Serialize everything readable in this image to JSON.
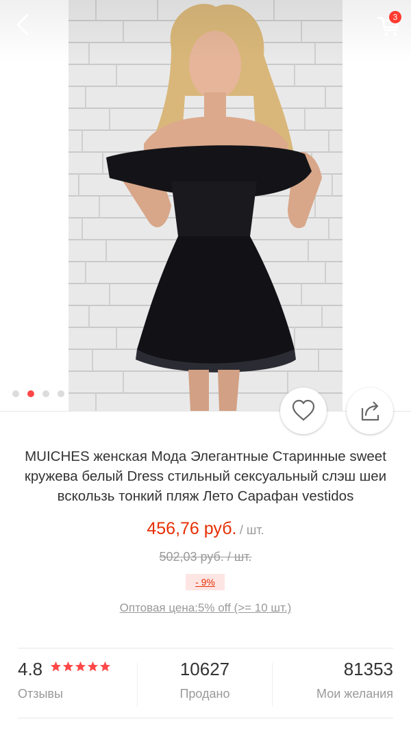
{
  "colors": {
    "accent": "#e62e04",
    "dot_active": "#ff4747",
    "badge": "#ff3b30"
  },
  "header": {
    "cart_count": "3"
  },
  "gallery": {
    "total": 4,
    "active_index": 1
  },
  "product": {
    "title": "MUICHES женская Мода Элегантные Старинные sweet кружева белый Dress стильный сексуальный слэш шеи вскользь тонкий пляж Лето Сарафан vestidos",
    "price": "456,76 руб.",
    "price_unit": "/ шт.",
    "old_price": "502,03 руб.  / шт.",
    "discount": "- 9%",
    "wholesale": "Оптовая цена:5% off (>= 10 шт.)"
  },
  "stats": {
    "rating": "4.8",
    "stars": 5,
    "reviews_label": "Отзывы",
    "sold_count": "10627",
    "sold_label": "Продано",
    "wishlist_count": "81353",
    "wishlist_label": "Мои желания"
  },
  "icons": [
    "back-arrow-icon",
    "cart-icon",
    "heart-icon",
    "share-icon",
    "star-icon"
  ]
}
